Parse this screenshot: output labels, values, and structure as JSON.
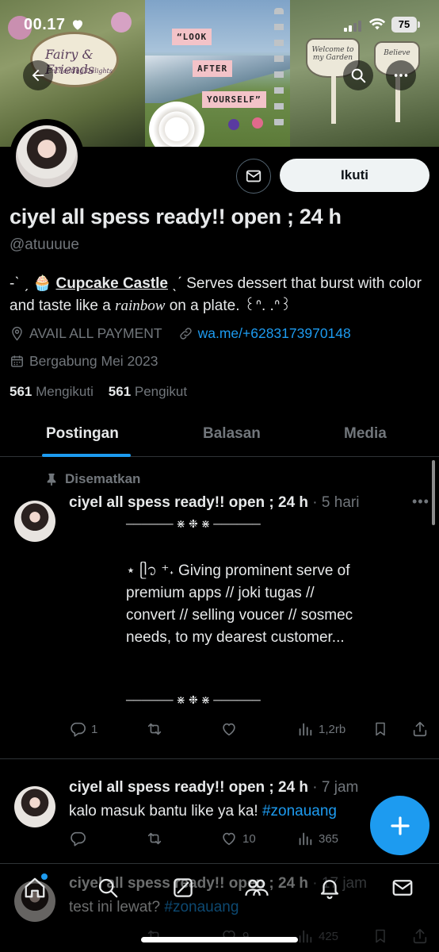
{
  "status_bar": {
    "time": "00.17",
    "battery": "75"
  },
  "banner": {
    "sign_title": "Fairy & Friends",
    "sign_sub": "Enchanting Delights",
    "sticker_1": "“LOOK",
    "sticker_2": "AFTER",
    "sticker_3": "YOURSELF”",
    "garden_sign_1": "Welcome to my Garden",
    "garden_sign_2": "Believe"
  },
  "profile": {
    "display_name": "ciyel all spess ready!! open ; 24 h",
    "handle": "@atuuuue",
    "bio_prefix": "-ˋ ˏ 🧁 ",
    "bio_link": "Cupcake Castle",
    "bio_part1": " ˎˊ Serves dessert that burst with color and taste like a ",
    "bio_italic": "rainbow",
    "bio_part2": " on a plate. ꒰ᐢ. .ᐢ꒱",
    "location": "AVAIL ALL PAYMENT",
    "website": "wa.me/+6283173970148",
    "joined": "Bergabung Mei 2023",
    "following_count": "561",
    "following_label": "Mengikuti",
    "followers_count": "561",
    "followers_label": "Pengikut",
    "follow_button": "Ikuti"
  },
  "tabs": [
    {
      "label": "Postingan",
      "active": true
    },
    {
      "label": "Balasan",
      "active": false
    },
    {
      "label": "Media",
      "active": false
    }
  ],
  "posts": [
    {
      "pinned_label": "Disematkan",
      "author": "ciyel all spess ready!! open ; 24 h",
      "time": "· 5 hari",
      "divider": "────── ⋇ ❉ ⋇ ──────",
      "body": "⋆ ᥫ᭡ ⁺˖ Giving prominent serve of premium apps // joki tugas // convert // selling voucer // sosmec needs, to my dearest customer...",
      "replies": "1",
      "retweets": "",
      "likes": "",
      "views": "1,2rb"
    },
    {
      "author": "ciyel all spess ready!! open ; 24 h",
      "time": "· 7 jam",
      "body": "kalo masuk bantu like ya ka! ",
      "hashtag": "#zonauang",
      "replies": "",
      "retweets": "",
      "likes": "10",
      "views": "365"
    },
    {
      "author": "ciyel all spess ready!! open ; 24 h",
      "time": "· 17 jam",
      "body": "test ini lewat? ",
      "hashtag": "#zonauang",
      "likes": "9",
      "views": "425"
    }
  ],
  "colors": {
    "accent": "#1d9bf0",
    "background": "#000000",
    "muted": "#71767b"
  }
}
